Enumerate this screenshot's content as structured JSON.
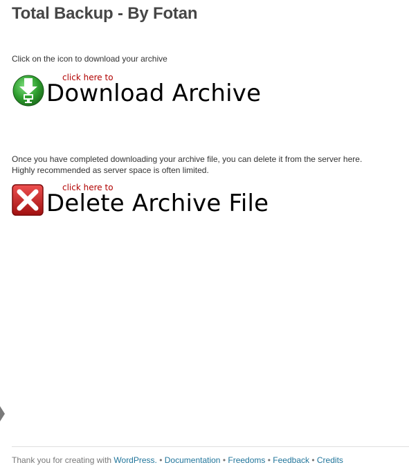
{
  "page": {
    "title": "Total Backup - By Fotan"
  },
  "download": {
    "intro": "Click on the icon to download your archive",
    "hint": "click here to",
    "label": "Download Archive",
    "icon": "download-arrow-icon",
    "icon_color": "#2f9e2f"
  },
  "delete": {
    "note_line1": "Once you have completed downloading your archive file, you can delete it from the server here.",
    "note_line2": "Highly recommended as server space is often limited.",
    "hint": "click here to",
    "label": "Delete Archive File",
    "icon": "delete-x-icon",
    "icon_color": "#c62020"
  },
  "footer": {
    "thanks": "Thank you for creating with ",
    "wordpress": "WordPress.",
    "links": [
      "Documentation",
      "Freedoms",
      "Feedback",
      "Credits"
    ],
    "separator": "•",
    "link_color": "#21759b"
  }
}
